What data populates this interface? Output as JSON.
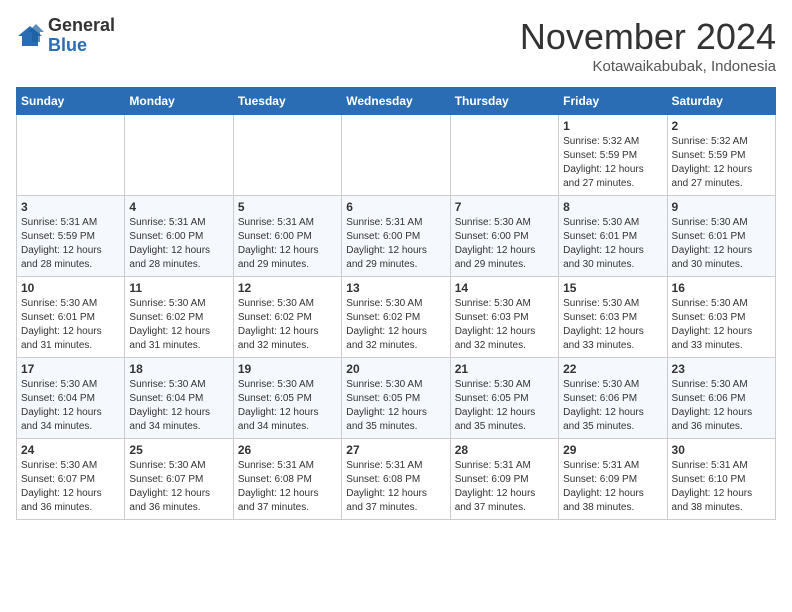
{
  "header": {
    "logo_general": "General",
    "logo_blue": "Blue",
    "month_title": "November 2024",
    "location": "Kotawaikabubak, Indonesia"
  },
  "weekdays": [
    "Sunday",
    "Monday",
    "Tuesday",
    "Wednesday",
    "Thursday",
    "Friday",
    "Saturday"
  ],
  "weeks": [
    [
      {
        "day": "",
        "info": ""
      },
      {
        "day": "",
        "info": ""
      },
      {
        "day": "",
        "info": ""
      },
      {
        "day": "",
        "info": ""
      },
      {
        "day": "",
        "info": ""
      },
      {
        "day": "1",
        "info": "Sunrise: 5:32 AM\nSunset: 5:59 PM\nDaylight: 12 hours\nand 27 minutes."
      },
      {
        "day": "2",
        "info": "Sunrise: 5:32 AM\nSunset: 5:59 PM\nDaylight: 12 hours\nand 27 minutes."
      }
    ],
    [
      {
        "day": "3",
        "info": "Sunrise: 5:31 AM\nSunset: 5:59 PM\nDaylight: 12 hours\nand 28 minutes."
      },
      {
        "day": "4",
        "info": "Sunrise: 5:31 AM\nSunset: 6:00 PM\nDaylight: 12 hours\nand 28 minutes."
      },
      {
        "day": "5",
        "info": "Sunrise: 5:31 AM\nSunset: 6:00 PM\nDaylight: 12 hours\nand 29 minutes."
      },
      {
        "day": "6",
        "info": "Sunrise: 5:31 AM\nSunset: 6:00 PM\nDaylight: 12 hours\nand 29 minutes."
      },
      {
        "day": "7",
        "info": "Sunrise: 5:30 AM\nSunset: 6:00 PM\nDaylight: 12 hours\nand 29 minutes."
      },
      {
        "day": "8",
        "info": "Sunrise: 5:30 AM\nSunset: 6:01 PM\nDaylight: 12 hours\nand 30 minutes."
      },
      {
        "day": "9",
        "info": "Sunrise: 5:30 AM\nSunset: 6:01 PM\nDaylight: 12 hours\nand 30 minutes."
      }
    ],
    [
      {
        "day": "10",
        "info": "Sunrise: 5:30 AM\nSunset: 6:01 PM\nDaylight: 12 hours\nand 31 minutes."
      },
      {
        "day": "11",
        "info": "Sunrise: 5:30 AM\nSunset: 6:02 PM\nDaylight: 12 hours\nand 31 minutes."
      },
      {
        "day": "12",
        "info": "Sunrise: 5:30 AM\nSunset: 6:02 PM\nDaylight: 12 hours\nand 32 minutes."
      },
      {
        "day": "13",
        "info": "Sunrise: 5:30 AM\nSunset: 6:02 PM\nDaylight: 12 hours\nand 32 minutes."
      },
      {
        "day": "14",
        "info": "Sunrise: 5:30 AM\nSunset: 6:03 PM\nDaylight: 12 hours\nand 32 minutes."
      },
      {
        "day": "15",
        "info": "Sunrise: 5:30 AM\nSunset: 6:03 PM\nDaylight: 12 hours\nand 33 minutes."
      },
      {
        "day": "16",
        "info": "Sunrise: 5:30 AM\nSunset: 6:03 PM\nDaylight: 12 hours\nand 33 minutes."
      }
    ],
    [
      {
        "day": "17",
        "info": "Sunrise: 5:30 AM\nSunset: 6:04 PM\nDaylight: 12 hours\nand 34 minutes."
      },
      {
        "day": "18",
        "info": "Sunrise: 5:30 AM\nSunset: 6:04 PM\nDaylight: 12 hours\nand 34 minutes."
      },
      {
        "day": "19",
        "info": "Sunrise: 5:30 AM\nSunset: 6:05 PM\nDaylight: 12 hours\nand 34 minutes."
      },
      {
        "day": "20",
        "info": "Sunrise: 5:30 AM\nSunset: 6:05 PM\nDaylight: 12 hours\nand 35 minutes."
      },
      {
        "day": "21",
        "info": "Sunrise: 5:30 AM\nSunset: 6:05 PM\nDaylight: 12 hours\nand 35 minutes."
      },
      {
        "day": "22",
        "info": "Sunrise: 5:30 AM\nSunset: 6:06 PM\nDaylight: 12 hours\nand 35 minutes."
      },
      {
        "day": "23",
        "info": "Sunrise: 5:30 AM\nSunset: 6:06 PM\nDaylight: 12 hours\nand 36 minutes."
      }
    ],
    [
      {
        "day": "24",
        "info": "Sunrise: 5:30 AM\nSunset: 6:07 PM\nDaylight: 12 hours\nand 36 minutes."
      },
      {
        "day": "25",
        "info": "Sunrise: 5:30 AM\nSunset: 6:07 PM\nDaylight: 12 hours\nand 36 minutes."
      },
      {
        "day": "26",
        "info": "Sunrise: 5:31 AM\nSunset: 6:08 PM\nDaylight: 12 hours\nand 37 minutes."
      },
      {
        "day": "27",
        "info": "Sunrise: 5:31 AM\nSunset: 6:08 PM\nDaylight: 12 hours\nand 37 minutes."
      },
      {
        "day": "28",
        "info": "Sunrise: 5:31 AM\nSunset: 6:09 PM\nDaylight: 12 hours\nand 37 minutes."
      },
      {
        "day": "29",
        "info": "Sunrise: 5:31 AM\nSunset: 6:09 PM\nDaylight: 12 hours\nand 38 minutes."
      },
      {
        "day": "30",
        "info": "Sunrise: 5:31 AM\nSunset: 6:10 PM\nDaylight: 12 hours\nand 38 minutes."
      }
    ]
  ]
}
